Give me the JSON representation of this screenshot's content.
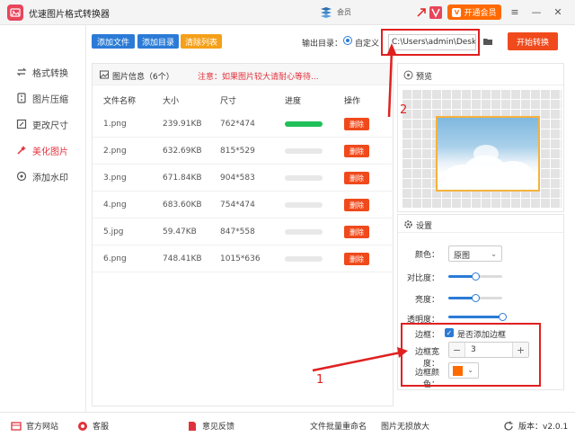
{
  "app": {
    "title": "优速图片格式转换器"
  },
  "titlebar": {
    "user_name": "会员",
    "vip_button": "开通会员",
    "vip_icon": "V"
  },
  "sidebar": {
    "items": [
      {
        "label": "格式转换",
        "icon": "convert-icon"
      },
      {
        "label": "图片压缩",
        "icon": "compress-icon"
      },
      {
        "label": "更改尺寸",
        "icon": "resize-icon"
      },
      {
        "label": "美化图片",
        "icon": "beautify-icon",
        "active": true
      },
      {
        "label": "添加水印",
        "icon": "watermark-icon"
      }
    ]
  },
  "toolbar": {
    "add_file": "添加文件",
    "add_dir": "添加目录",
    "clear_list": "清除列表",
    "output_label": "输出目录：",
    "output_radio": "自定义",
    "output_path": "C:\\Users\\admin\\Desktop",
    "start_button": "开始转换"
  },
  "file_panel": {
    "info_label": "图片信息（6个）",
    "warning": "注意：如果图片较大请耐心等待...",
    "columns": [
      "文件名称",
      "大小",
      "尺寸",
      "进度",
      "操作"
    ],
    "delete_label": "删除",
    "rows": [
      {
        "name": "1.png",
        "size": "239.91KB",
        "dims": "762*474",
        "progress": 1.0
      },
      {
        "name": "2.png",
        "size": "632.69KB",
        "dims": "815*529",
        "progress": 0
      },
      {
        "name": "3.png",
        "size": "671.84KB",
        "dims": "904*583",
        "progress": 0
      },
      {
        "name": "4.png",
        "size": "683.60KB",
        "dims": "754*474",
        "progress": 0
      },
      {
        "name": "5.jpg",
        "size": "59.47KB",
        "dims": "847*558",
        "progress": 0
      },
      {
        "name": "6.png",
        "size": "748.41KB",
        "dims": "1015*636",
        "progress": 0
      }
    ]
  },
  "preview": {
    "title": "预览"
  },
  "settings": {
    "title": "设置",
    "color_label": "颜色：",
    "color_value": "原图",
    "contrast_label": "对比度：",
    "contrast_level": 0.5,
    "brightness_label": "亮度：",
    "brightness_level": 0.5,
    "transparency_label": "透明度：",
    "transparency_level": 1.0,
    "border_label": "边框：",
    "border_checkbox": "是否添加边框",
    "border_width_label": "边框宽度：",
    "border_width_value": "3",
    "border_color_label": "边框颜色：",
    "border_color": "#ff6a00"
  },
  "annotations": {
    "one": "1",
    "two": "2"
  },
  "footer": {
    "website": "官方网站",
    "service": "客服",
    "feedback": "意见反馈",
    "batch_rename": "文件批量重命名",
    "lossless_enlarge": "图片无损放大",
    "version": "版本：v2.0.1"
  },
  "colors": {
    "accent": "#2b7bd6",
    "danger": "#f04a1c",
    "orange": "#ff6a00",
    "active": "#e0323c",
    "progress": "#20c05a"
  }
}
